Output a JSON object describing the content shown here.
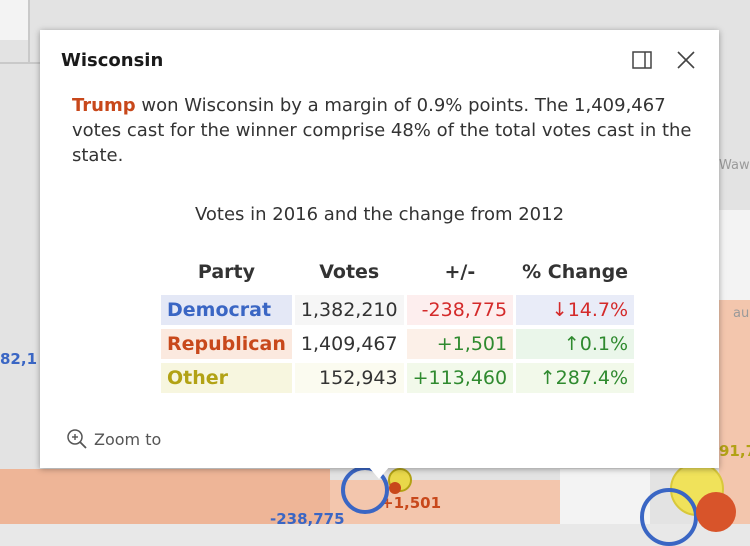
{
  "map": {
    "labels": {
      "left_value": "82,1",
      "bottom_value": "-238,775",
      "pointer_value": "+1,501",
      "right_value": "91,7",
      "town_1": "Waw",
      "town_2": "ault"
    },
    "colors": {
      "democrat": "#3a66c4",
      "republican": "#c8481b",
      "other": "#b2a215",
      "county_fill": "#f3c6ad"
    }
  },
  "popup": {
    "title": "Wisconsin",
    "dock_icon": "dock-side-icon",
    "close_icon": "close-icon",
    "summary": {
      "winner": "Trump",
      "text": " won Wisconsin by a margin of 0.9% points. The 1,409,467 votes cast for the winner comprise 48% of the total votes cast in the state."
    },
    "table": {
      "caption": "Votes in 2016 and the change from 2012",
      "headers": [
        "Party",
        "Votes",
        "+/-",
        "% Change"
      ],
      "rows": [
        {
          "party": "Democrat",
          "votes": "1,382,210",
          "diff": "-238,775",
          "pct": "↓14.7%"
        },
        {
          "party": "Republican",
          "votes": "1,409,467",
          "diff": "+1,501",
          "pct": "↑0.1%"
        },
        {
          "party": "Other",
          "votes": "152,943",
          "diff": "+113,460",
          "pct": "↑287.4%"
        }
      ]
    },
    "zoom_label": "Zoom to",
    "zoom_icon": "zoom-in-icon"
  }
}
